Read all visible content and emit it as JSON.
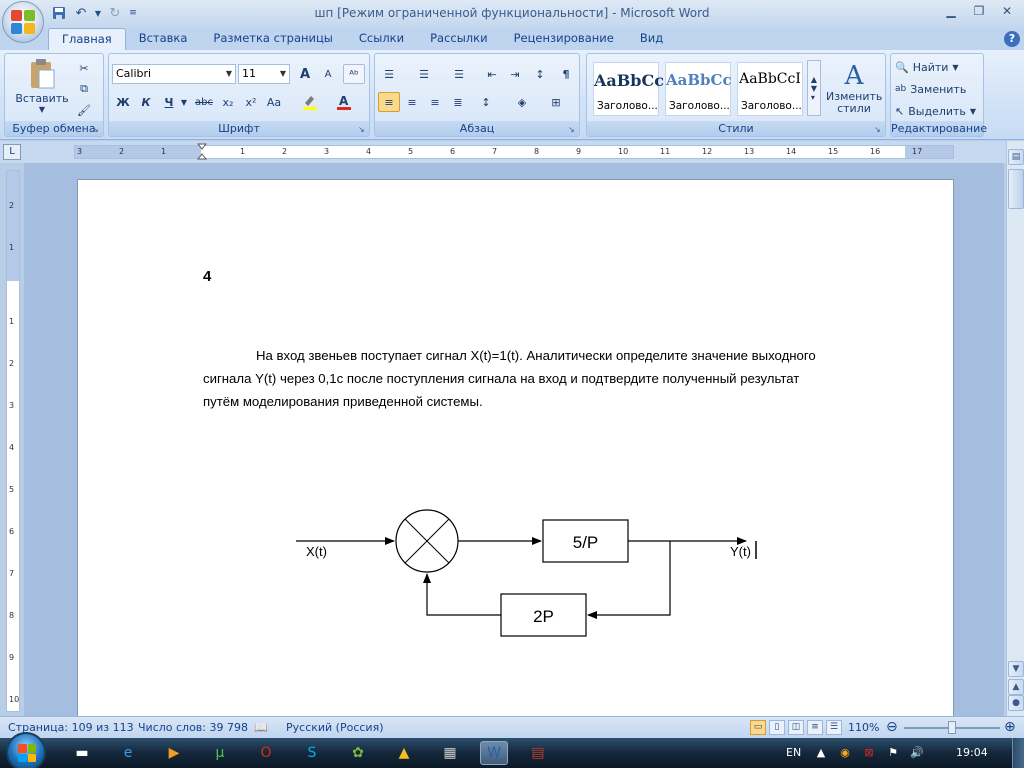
{
  "window": {
    "title": "шп [Режим ограниченной функциональности] - Microsoft Word"
  },
  "qat": {
    "save_icon": "save-icon",
    "undo_icon": "undo-icon",
    "redo_icon": "redo-icon"
  },
  "tabs": [
    "Главная",
    "Вставка",
    "Разметка страницы",
    "Ссылки",
    "Рассылки",
    "Рецензирование",
    "Вид"
  ],
  "ribbon": {
    "clipboard": {
      "label": "Буфер обмена",
      "paste": "Вставить"
    },
    "font": {
      "label": "Шрифт",
      "name": "Calibri",
      "size": "11",
      "bold": "Ж",
      "italic": "К",
      "underline": "Ч",
      "strike": "abc",
      "subscript": "x₂",
      "superscript": "x²",
      "case": "Aa",
      "grow": "A",
      "shrink": "A"
    },
    "paragraph": {
      "label": "Абзац",
      "pilcrow": "¶"
    },
    "styles": {
      "label": "Стили",
      "items": [
        {
          "sample": "AaBbCc",
          "name": "Заголово..."
        },
        {
          "sample": "AaBbCc",
          "name": "Заголово..."
        },
        {
          "sample": "AaBbCcI",
          "name": "Заголово..."
        }
      ],
      "change": "Изменить стили"
    },
    "editing": {
      "label": "Редактирование",
      "find": "Найти",
      "replace": "Заменить",
      "select": "Выделить"
    }
  },
  "ruler": {
    "h_numbers": [
      "3",
      "2",
      "1",
      "1",
      "2",
      "3",
      "4",
      "5",
      "6",
      "7",
      "8",
      "9",
      "10",
      "11",
      "12",
      "13",
      "14",
      "15",
      "16",
      "17"
    ],
    "v_numbers": [
      "2",
      "1",
      "1",
      "2",
      "3",
      "4",
      "5",
      "6",
      "7",
      "8",
      "9",
      "10"
    ]
  },
  "document": {
    "task_number": "4",
    "paragraph_lines": [
      "На вход звеньев поступает сигнал X(t)=1(t). Аналитически определите  значение выходного",
      "сигнала Y(t) через 0,1с после поступления  сигнала на вход и подтвердите  полученный результат",
      "путём моделирования приведенной системы."
    ],
    "diagram": {
      "input_label": "X(t)",
      "output_label": "Y(t)",
      "forward_block": "5/P",
      "feedback_block": "2P"
    }
  },
  "status": {
    "page": "Страница: 109 из 113",
    "words": "Число слов: 39 798",
    "language": "Русский (Россия)",
    "zoom": "110%"
  },
  "taskbar": {
    "language": "EN",
    "clock": "19:04"
  },
  "colors": {
    "ribbon_text": "#15428b",
    "office_logo": [
      "#e2492f",
      "#7cbb2a",
      "#2c88d6",
      "#f3b61f"
    ]
  }
}
